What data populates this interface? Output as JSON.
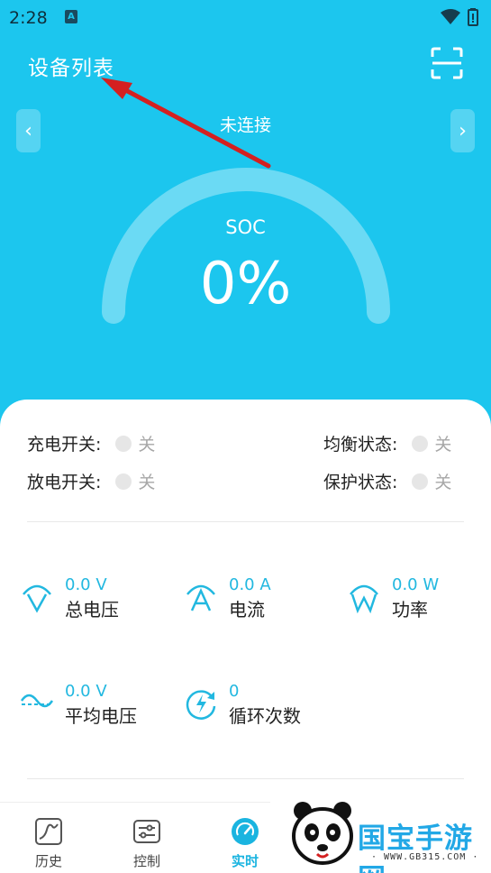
{
  "status_bar": {
    "time": "2:28",
    "indicator": "A"
  },
  "header": {
    "title": "设备列表",
    "scan_icon": "scan-icon"
  },
  "carousel": {
    "prev": "‹",
    "next": "›"
  },
  "connection": {
    "status": "未连接"
  },
  "soc": {
    "label": "SOC",
    "value": "0%",
    "percent": 0
  },
  "switches": {
    "charge": {
      "label": "充电开关:",
      "state": "关"
    },
    "discharge": {
      "label": "放电开关:",
      "state": "关"
    },
    "balance": {
      "label": "均衡状态:",
      "state": "关"
    },
    "protect": {
      "label": "保护状态:",
      "state": "关"
    }
  },
  "metrics": {
    "total_voltage": {
      "value": "0.0 V",
      "name": "总电压",
      "icon": "voltage-icon"
    },
    "current": {
      "value": "0.0 A",
      "name": "电流",
      "icon": "current-icon"
    },
    "power": {
      "value": "0.0 W",
      "name": "功率",
      "icon": "power-icon"
    },
    "avg_voltage": {
      "value": "0.0 V",
      "name": "平均电压",
      "icon": "avg-voltage-icon"
    },
    "cycles": {
      "value": "0",
      "name": "循环次数",
      "icon": "cycle-icon"
    }
  },
  "bottom_nav": {
    "history": "历史",
    "control": "控制",
    "realtime": "实时"
  },
  "watermark": {
    "brand": "国宝手游网",
    "url": "· WWW.GB315.COM ·"
  },
  "colors": {
    "primary": "#1cc6ee",
    "accent": "#22b8e0",
    "annotation": "#d42020"
  }
}
